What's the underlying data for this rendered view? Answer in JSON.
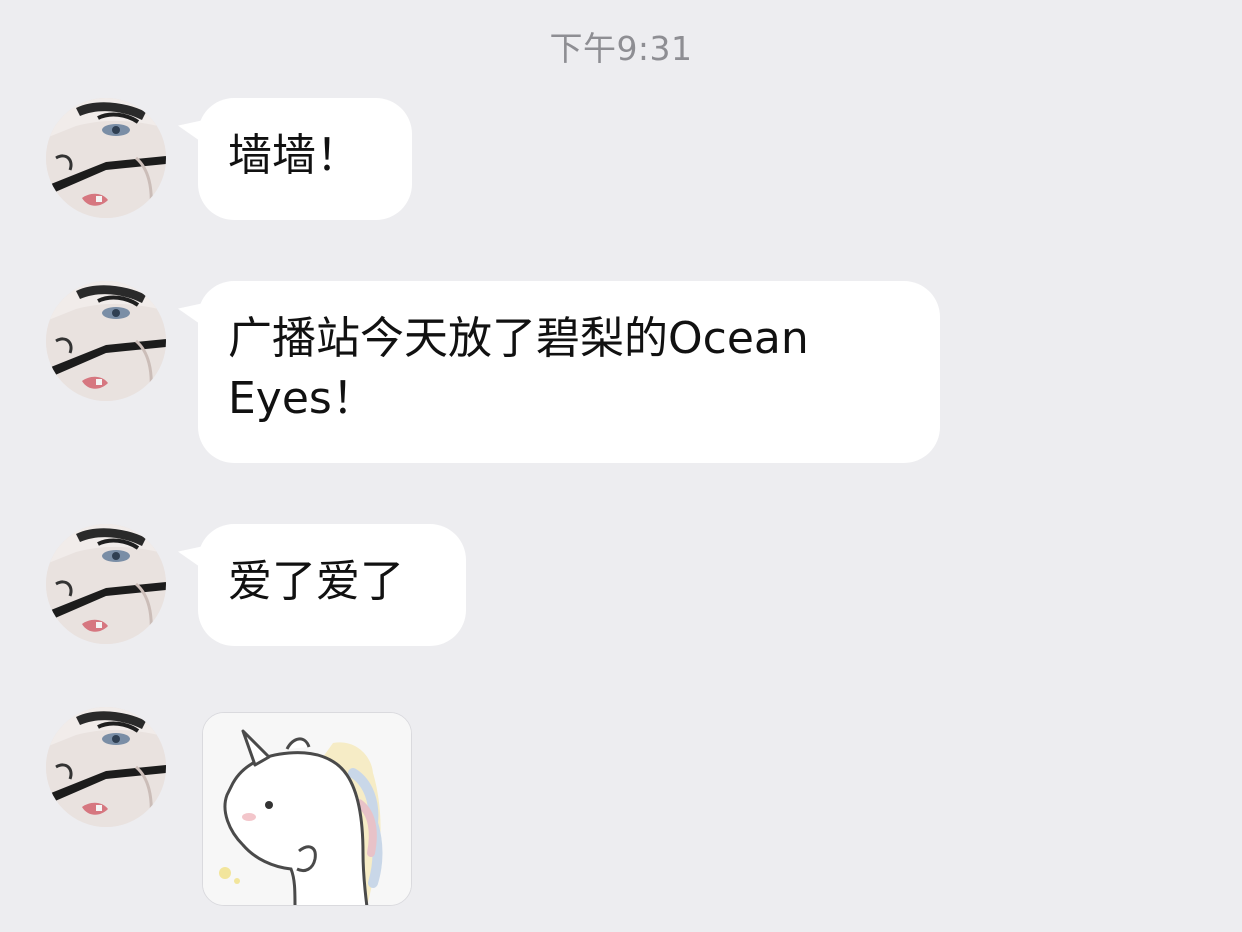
{
  "status": {
    "timestamp": "下午9:31"
  },
  "messages": [
    {
      "text": "墙墙！"
    },
    {
      "text": "广播站今天放了碧梨的Ocean\nEyes！"
    },
    {
      "text": "爱了爱了"
    }
  ],
  "sticker": {
    "icon": "unicorn-sticker-icon"
  },
  "avatar": {
    "icon": "user-avatar-icon"
  }
}
